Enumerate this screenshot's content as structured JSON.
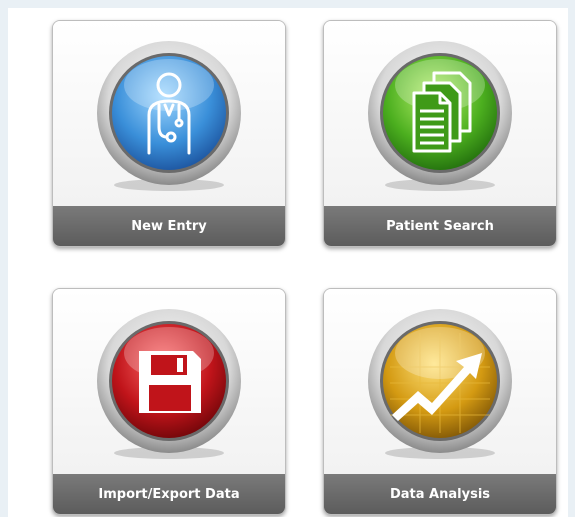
{
  "tiles": [
    {
      "label": "New Entry",
      "icon": "doctor-icon",
      "color": "#3a8fd9"
    },
    {
      "label": "Patient Search",
      "icon": "documents-icon",
      "color": "#4caf1f"
    },
    {
      "label": "Import/Export Data",
      "icon": "floppy-disk-icon",
      "color": "#c0141a"
    },
    {
      "label": "Data Analysis",
      "icon": "growth-chart-icon",
      "color": "#d49a12"
    }
  ]
}
